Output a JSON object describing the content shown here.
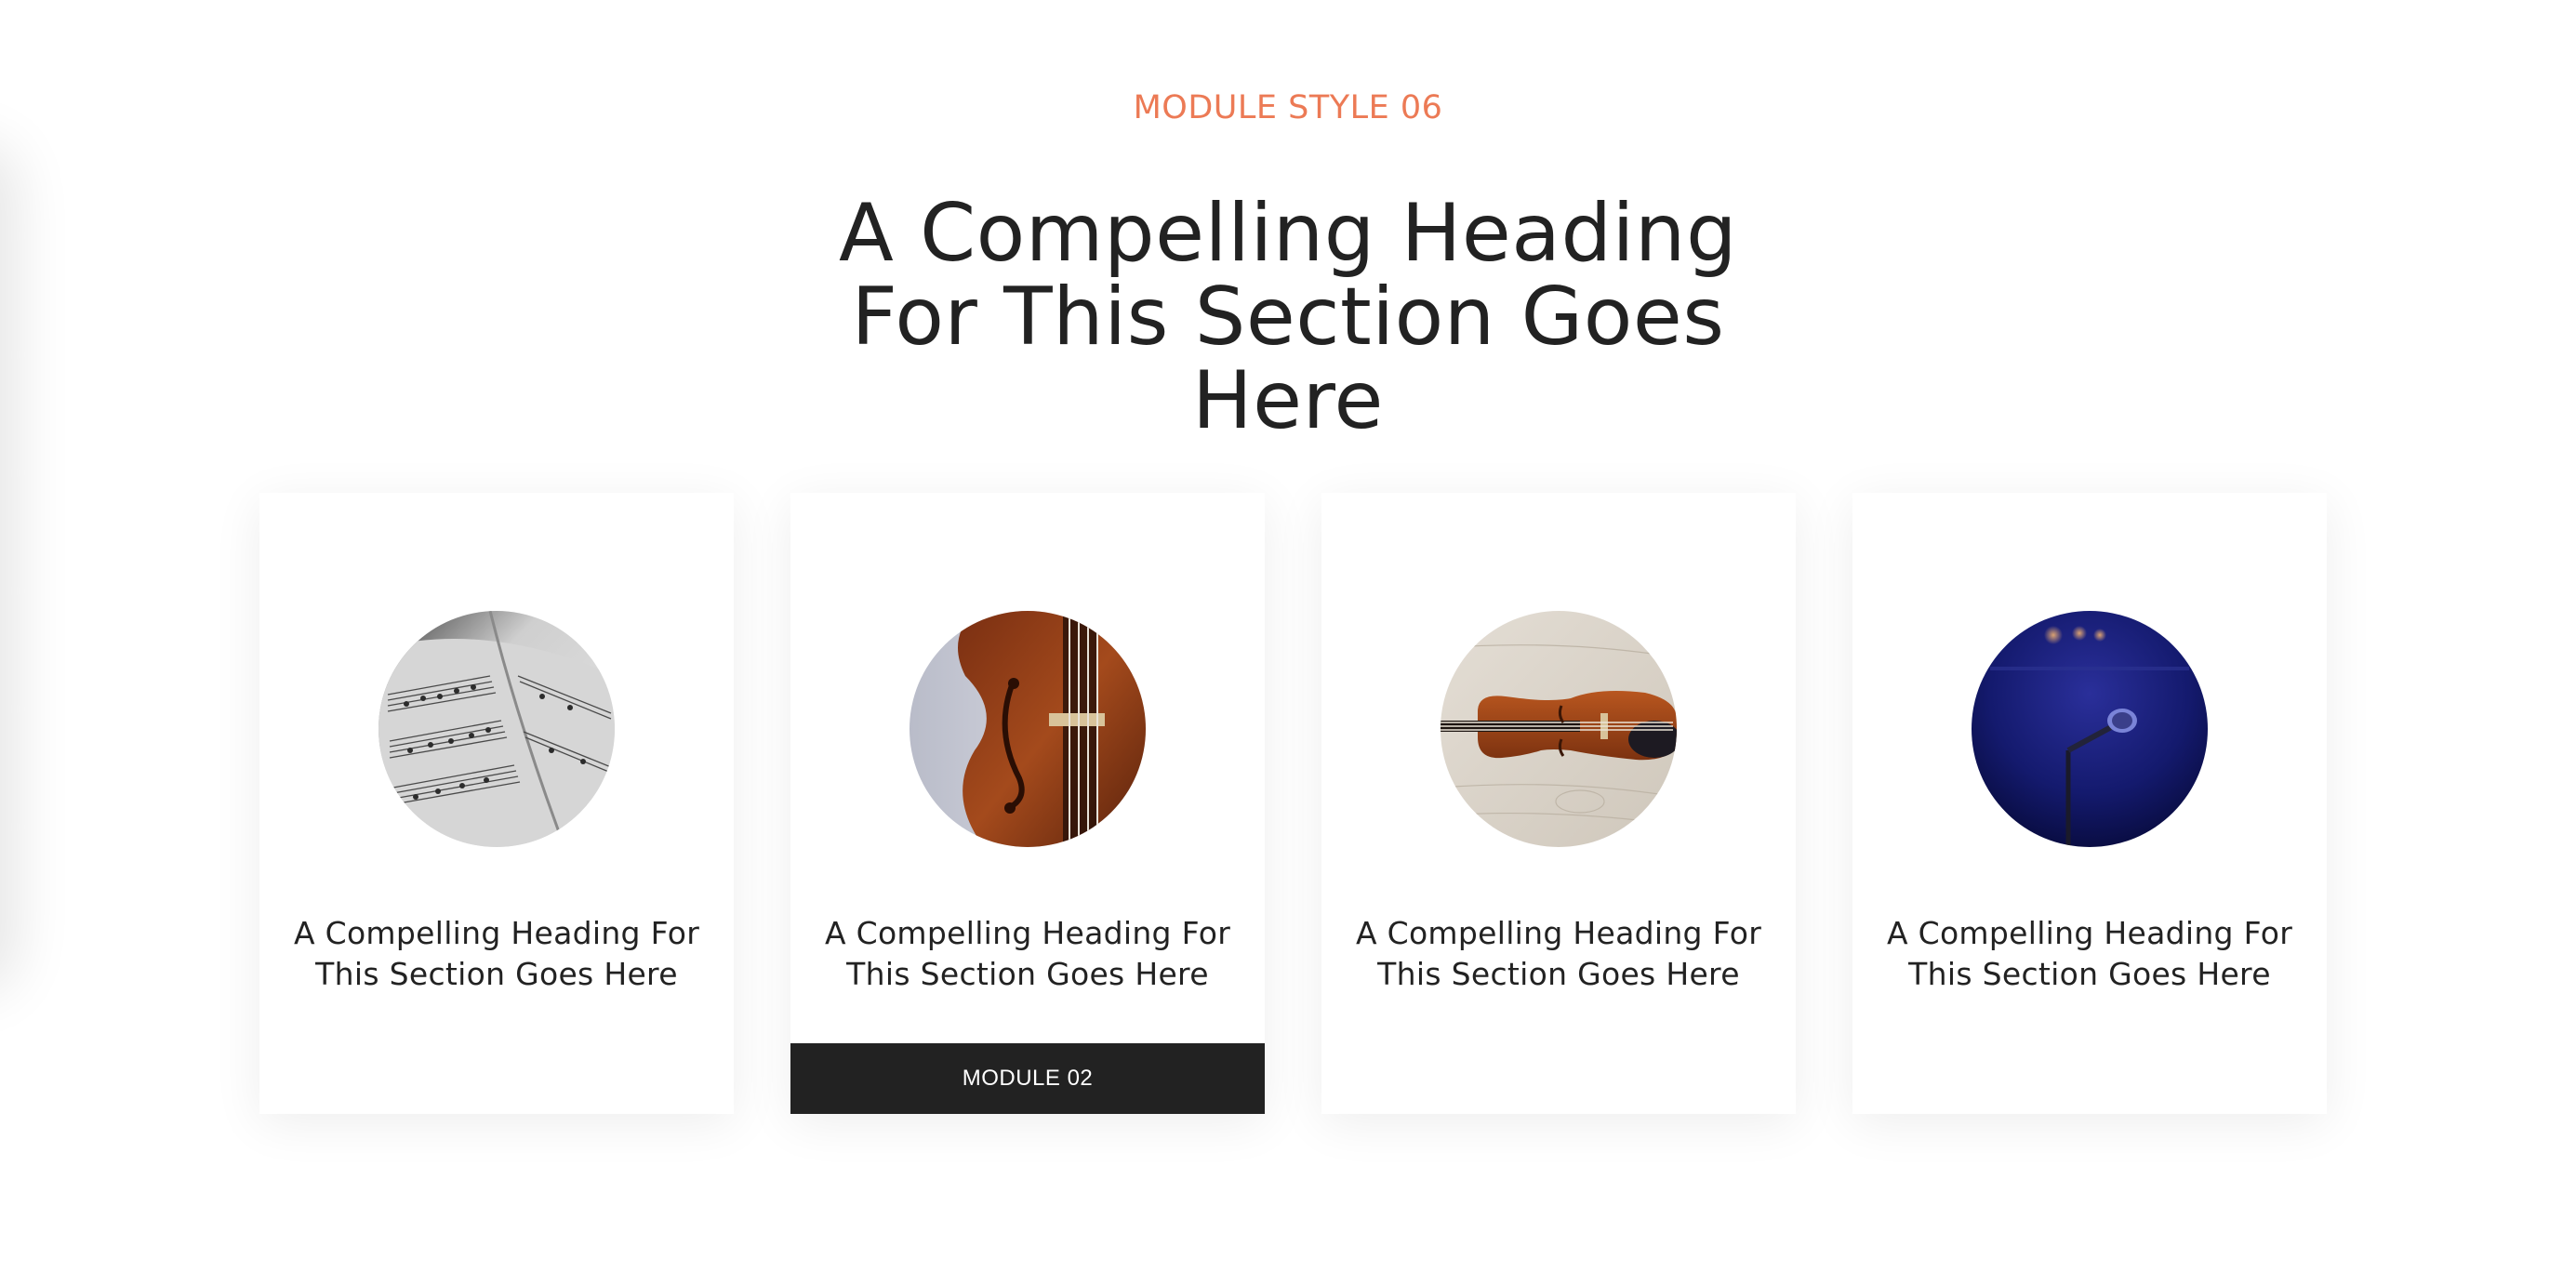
{
  "section": {
    "eyebrow": "MODULE STYLE 06",
    "heading": "A Compelling Heading For This Section Goes Here"
  },
  "cards": [
    {
      "image": "sheet-music-photo",
      "heading": "A Compelling Heading For This Section Goes Here"
    },
    {
      "image": "violin-closeup-photo",
      "heading": "A Compelling Heading For This Section Goes Here",
      "tag": "MODULE 02"
    },
    {
      "image": "violin-on-wood-photo",
      "heading": "A Compelling Heading For This Section Goes Here"
    },
    {
      "image": "stage-microphone-photo",
      "heading": "A Compelling Heading For This Section Goes Here"
    }
  ],
  "colors": {
    "accent": "#ec7a55",
    "text": "#222222",
    "tag_bg": "#222222"
  }
}
